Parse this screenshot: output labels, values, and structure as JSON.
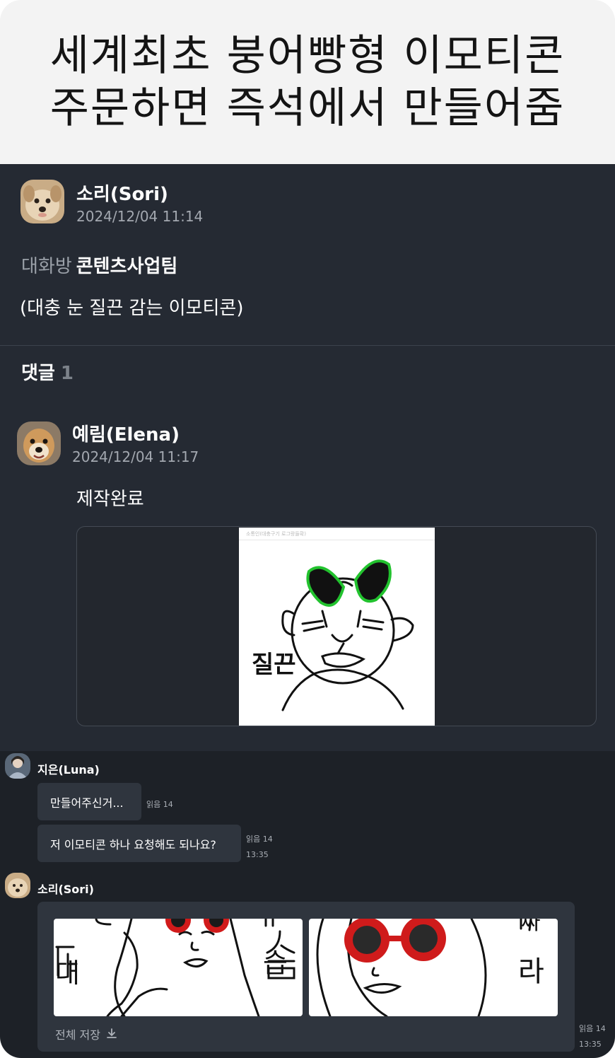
{
  "headline": {
    "line1": "세계최초 붕어빵형 이모티콘",
    "line2": "주문하면 즉석에서 만들어줌"
  },
  "post": {
    "author": "소리(Sori)",
    "timestamp": "2024/12/04 11:14",
    "room_label": "대화방",
    "room_name": "콘텐츠사업팀",
    "body": "(대충 눈 질끈 감는 이모티콘)",
    "comments_label": "댓글",
    "comments_count": "1"
  },
  "comment": {
    "author": "예림(Elena)",
    "timestamp": "2024/12/04 11:17",
    "text": "제작완료",
    "image_header_text": "소통인(대충구기 로그랑들확)",
    "image_caption": "질끈"
  },
  "chat": {
    "messages": [
      {
        "sender": "지은(Luna)",
        "bubbles": [
          {
            "text": "만들어주신거...",
            "read": "읽음 14"
          },
          {
            "text": "저 이모티콘 하나 요청해도 되나요?",
            "read": "읽음 14",
            "time": "13:35"
          }
        ]
      },
      {
        "sender": "소리(Sori)",
        "images": [
          {
            "chars": [
              "대",
              "습"
            ]
          },
          {
            "chars": [
              "라",
              "싸"
            ]
          }
        ],
        "save_all": "전체 저장",
        "read": "읽음 14",
        "time": "13:35"
      }
    ]
  },
  "colors": {
    "post_bg": "#252a33",
    "chat_bg": "#1d2127",
    "bubble_bg": "#2f353e",
    "headline_bg": "#f3f3f3",
    "accent_green": "#22c22e",
    "accent_red": "#d21f1f"
  },
  "icons": [
    "dog-avatar-icon",
    "download-icon"
  ]
}
